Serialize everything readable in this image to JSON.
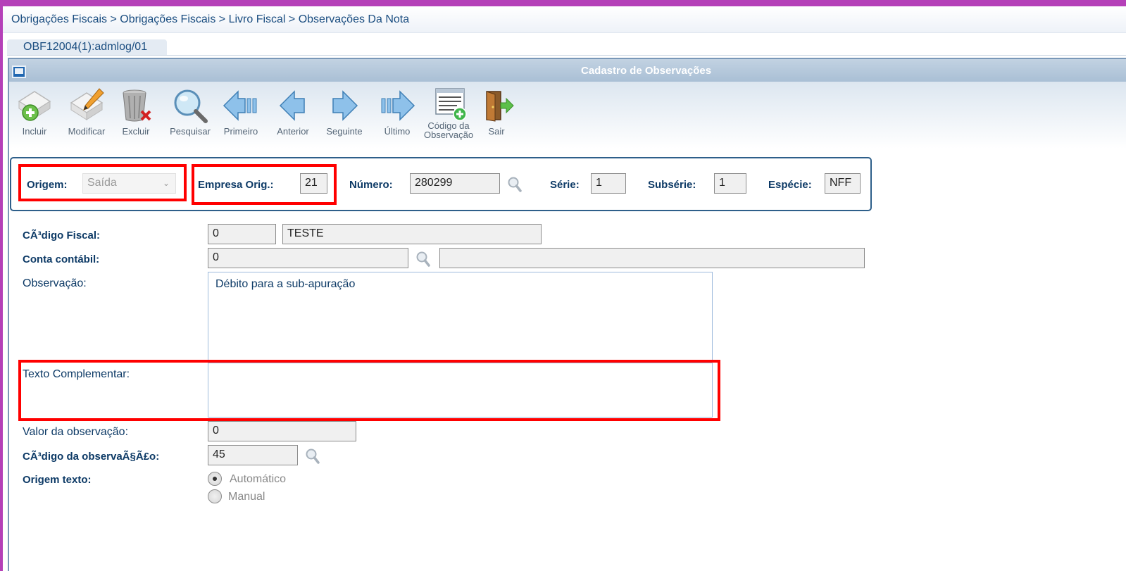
{
  "breadcrumb": "Obrigações Fiscais > Obrigações Fiscais > Livro Fiscal > Observações Da Nota",
  "tab": {
    "label": "OBF12004(1):admlog/01"
  },
  "window": {
    "title": "Cadastro de Observações"
  },
  "toolbar": {
    "incluir": "Incluir",
    "modificar": "Modificar",
    "excluir": "Excluir",
    "pesquisar": "Pesquisar",
    "primeiro": "Primeiro",
    "anterior": "Anterior",
    "seguinte": "Seguinte",
    "ultimo": "Último",
    "codigo_observacao": "Código da\nObservação",
    "sair": "Sair"
  },
  "key": {
    "origem_label": "Origem:",
    "origem_value": "Saída",
    "empresa_label": "Empresa Orig.:",
    "empresa_value": "21",
    "numero_label": "Número:",
    "numero_value": "280299",
    "serie_label": "Série:",
    "serie_value": "1",
    "subserie_label": "Subsérie:",
    "subserie_value": "1",
    "especie_label": "Espécie:",
    "especie_value": "NFF"
  },
  "form": {
    "codigo_fiscal_label": "CÃ³digo Fiscal:",
    "codigo_fiscal_code": "0",
    "codigo_fiscal_desc": "TESTE",
    "conta_label": "Conta contábil:",
    "conta_value": "0",
    "conta_desc": "",
    "observacao_label": "Observação:",
    "observacao_value": "Débito para a sub-apuração",
    "texto_label": "Texto Complementar:",
    "texto_value": "",
    "valor_label": "Valor da observação:",
    "valor_value": "0",
    "codigo_obs_label": "CÃ³digo da observaÃ§Ã£o:",
    "codigo_obs_value": "45",
    "origem_texto_label": "Origem texto:",
    "origem_texto_options": [
      "Automático",
      "Manual"
    ],
    "origem_texto_selected": "Automático"
  },
  "colors": {
    "highlight": "#ff0000",
    "frame": "#b540b8",
    "label": "#0d3a66"
  }
}
